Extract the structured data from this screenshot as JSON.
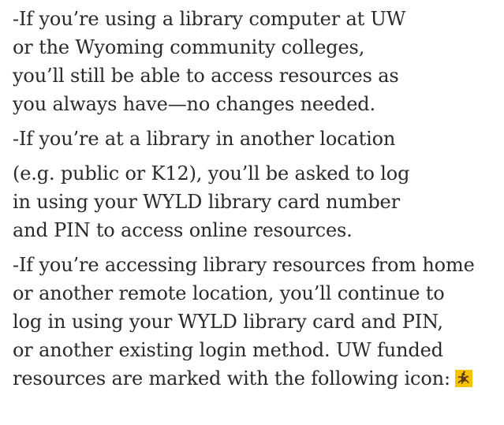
{
  "paragraphs": [
    {
      "lines": [
        "-If you’re using a library computer at UW",
        "or the Wyoming community colleges,",
        "you’ll still be able to access resources as",
        "you always have—no changes needed."
      ]
    },
    {
      "lines": [
        "-If you’re at a library in another location",
        "(e.g. public or K12), you’ll be asked to log",
        "in using your WYLD library card number",
        "and PIN to access online resources."
      ]
    },
    {
      "lines": [
        "-If you’re accessing library resources from home",
        "or another remote location, you’ll continue to",
        "log in using your WYLD library card and PIN,",
        "or another existing login method. UW funded",
        "resources are marked with the following icon:"
      ]
    }
  ],
  "icons": {
    "uw_funded_icon": "uw-bucking-horse-icon",
    "icon_colors": {
      "background": "#f5c400",
      "figure": "#5a3a1a"
    }
  }
}
